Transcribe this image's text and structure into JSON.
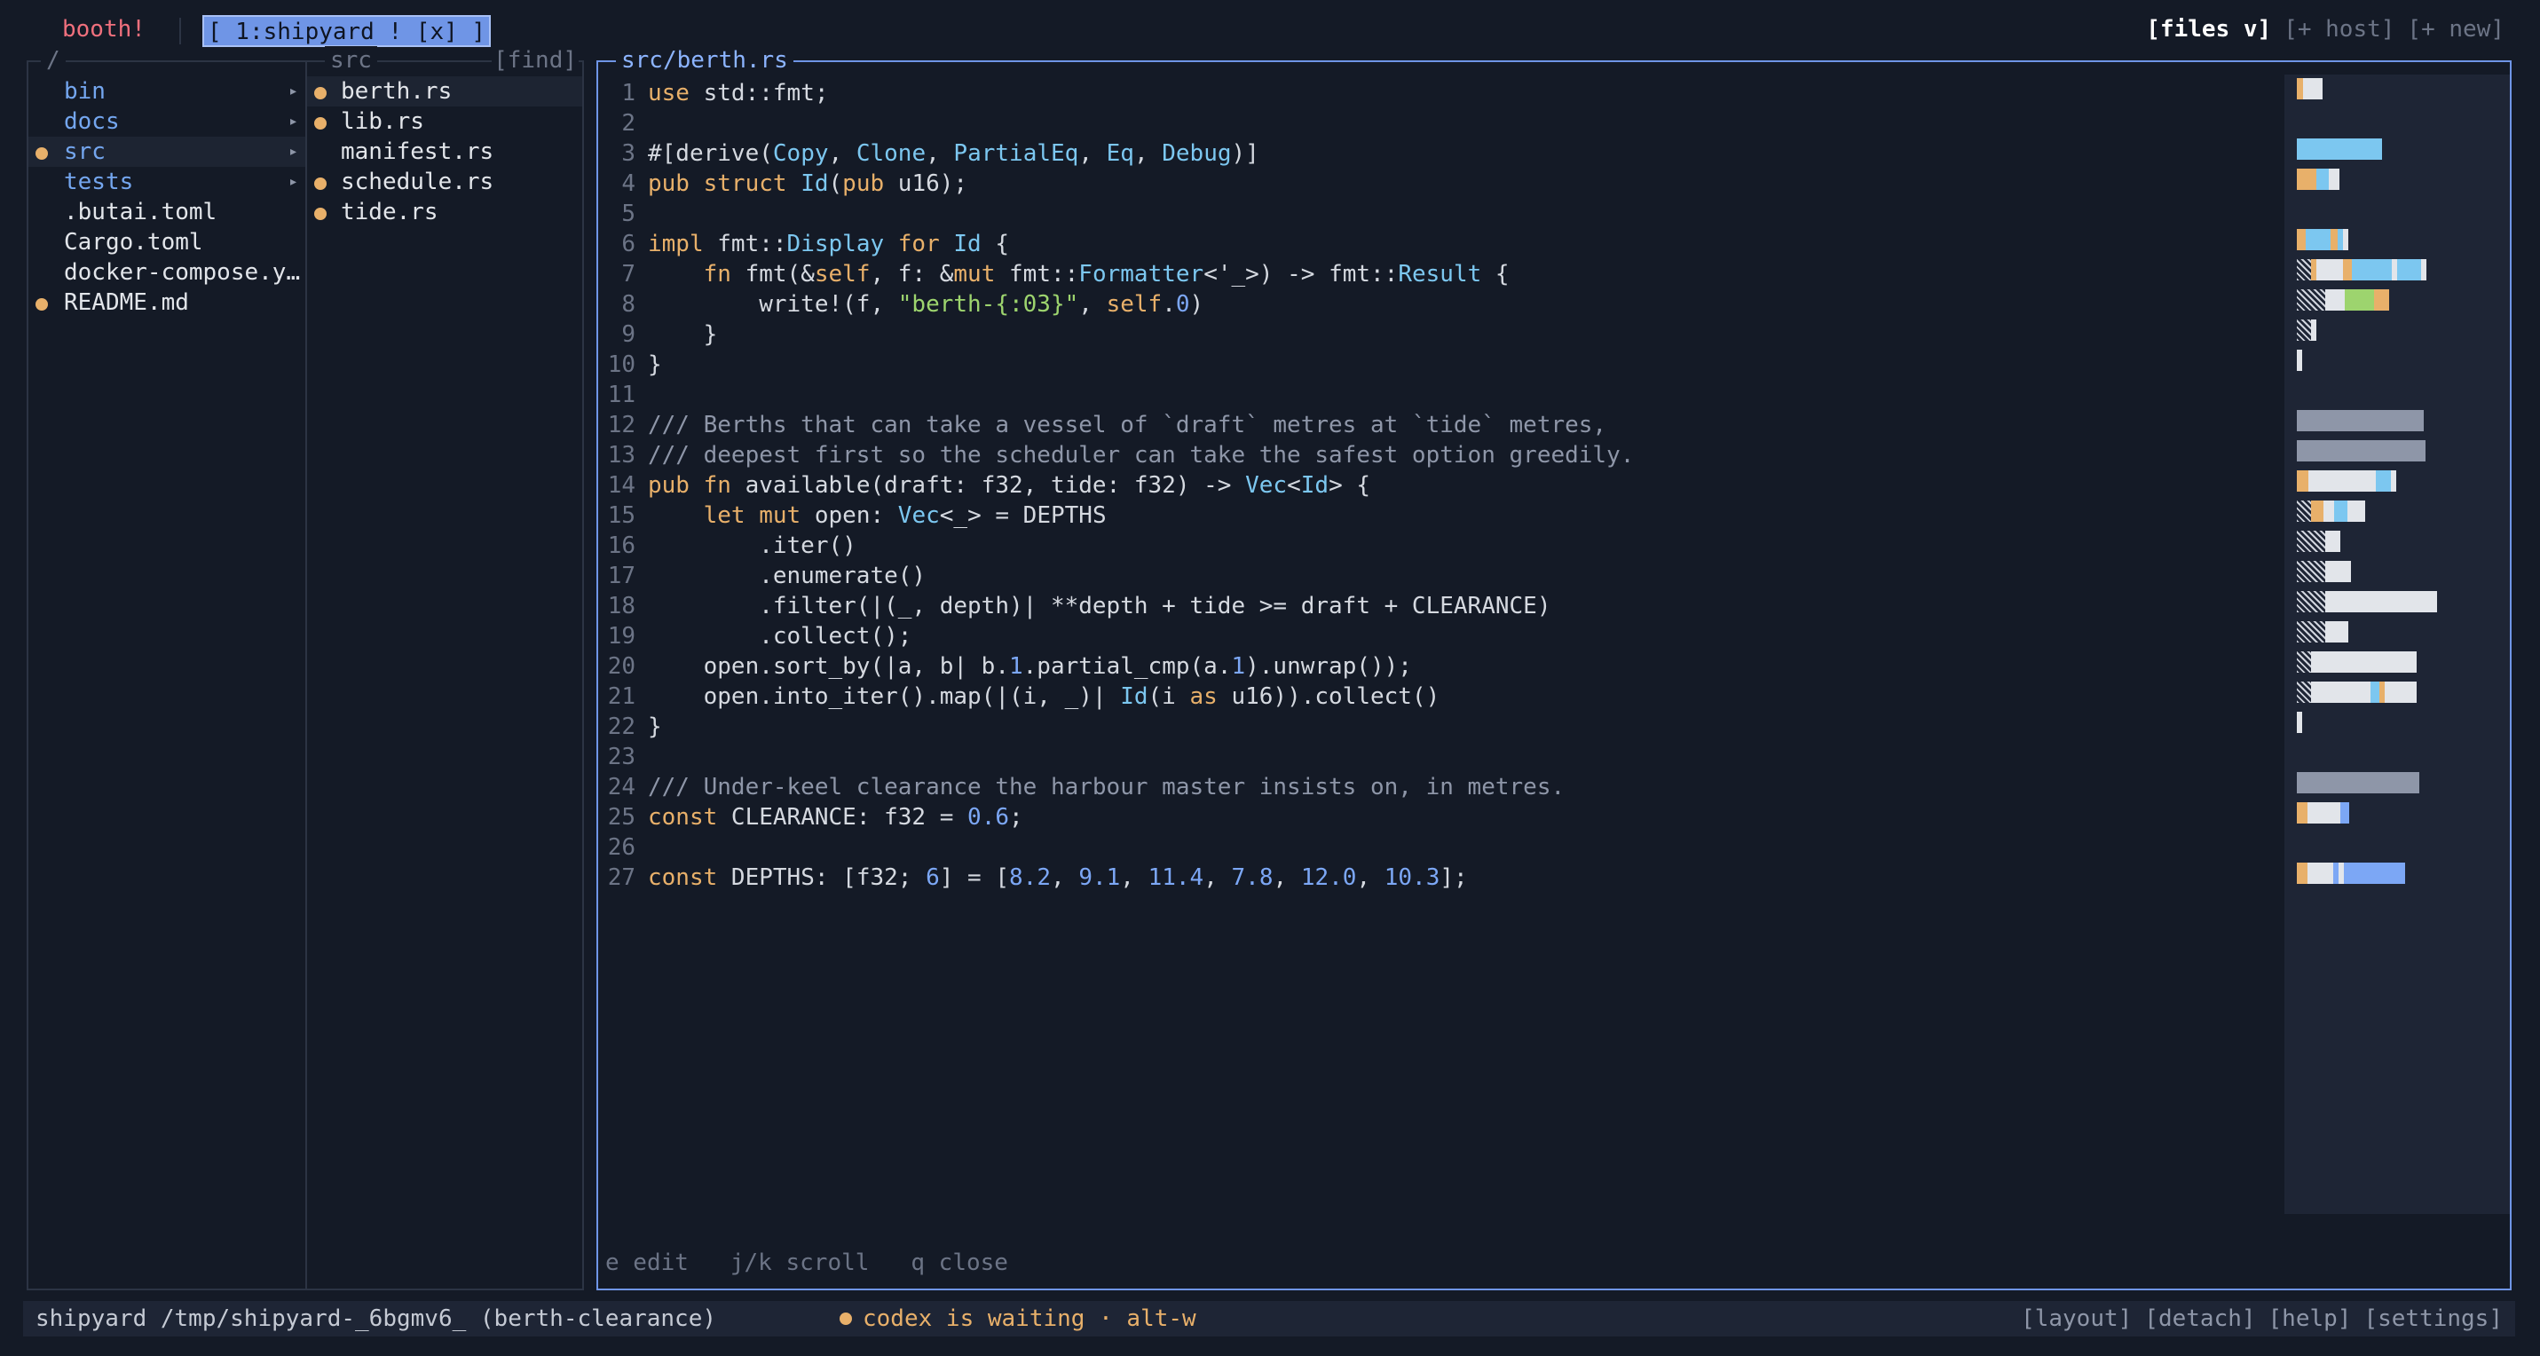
{
  "topbar": {
    "brand": "booth!",
    "active_tab": "[ 1:shipyard ! [x] ]",
    "files_menu": "[files v]",
    "host_button": "[+ host]",
    "new_button": "[+ new]"
  },
  "left_panel": {
    "title": "/",
    "items": [
      {
        "name": "bin",
        "type": "dir",
        "modified": false,
        "selected": false
      },
      {
        "name": "docs",
        "type": "dir",
        "modified": false,
        "selected": false
      },
      {
        "name": "src",
        "type": "dir",
        "modified": true,
        "selected": true
      },
      {
        "name": "tests",
        "type": "dir",
        "modified": false,
        "selected": false
      },
      {
        "name": ".butai.toml",
        "type": "file",
        "modified": false,
        "selected": false
      },
      {
        "name": "Cargo.toml",
        "type": "file",
        "modified": false,
        "selected": false
      },
      {
        "name": "docker-compose.y…",
        "type": "file",
        "modified": false,
        "selected": false
      },
      {
        "name": "README.md",
        "type": "file",
        "modified": true,
        "selected": false
      }
    ]
  },
  "mid_panel": {
    "title": "src",
    "find_label": "[find]",
    "items": [
      {
        "name": "berth.rs",
        "modified": true,
        "selected": true
      },
      {
        "name": "lib.rs",
        "modified": true,
        "selected": false
      },
      {
        "name": "manifest.rs",
        "modified": false,
        "selected": false
      },
      {
        "name": "schedule.rs",
        "modified": true,
        "selected": false
      },
      {
        "name": "tide.rs",
        "modified": true,
        "selected": false
      }
    ]
  },
  "editor": {
    "title": "src/berth.rs",
    "hint": "e edit   j/k scroll   q close",
    "lines": [
      "use std::fmt;",
      "",
      "#[derive(Copy, Clone, PartialEq, Eq, Debug)]",
      "pub struct Id(pub u16);",
      "",
      "impl fmt::Display for Id {",
      "    fn fmt(&self, f: &mut fmt::Formatter<'_>) -> fmt::Result {",
      "        write!(f, \"berth-{:03}\", self.0)",
      "    }",
      "}",
      "",
      "/// Berths that can take a vessel of `draft` metres at `tide` metres,",
      "/// deepest first so the scheduler can take the safest option greedily.",
      "pub fn available(draft: f32, tide: f32) -> Vec<Id> {",
      "    let mut open: Vec<_> = DEPTHS",
      "        .iter()",
      "        .enumerate()",
      "        .filter(|(_, depth)| **depth + tide >= draft + CLEARANCE)",
      "        .collect();",
      "    open.sort_by(|a, b| b.1.partial_cmp(a.1).unwrap());",
      "    open.into_iter().map(|(i, _)| Id(i as u16)).collect()",
      "}",
      "",
      "/// Under-keel clearance the harbour master insists on, in metres.",
      "const CLEARANCE: f32 = 0.6;",
      "",
      "const DEPTHS: [f32; 6] = [8.2, 9.1, 11.4, 7.8, 12.0, 10.3];"
    ]
  },
  "statusbar": {
    "session": "shipyard /tmp/shipyard-_6bgmv6_ (berth-clearance)",
    "notice": "codex is waiting · alt-w",
    "actions": [
      "[layout]",
      "[detach]",
      "[help]",
      "[settings]"
    ]
  },
  "colors": {
    "background": "#141a26",
    "accent": "#6f95e6",
    "keyword": "#e8b06a",
    "type": "#7cc7f0",
    "number": "#7ca7f5",
    "string": "#9dd46e",
    "comment": "#8e96a8",
    "brand": "#f0707d"
  }
}
